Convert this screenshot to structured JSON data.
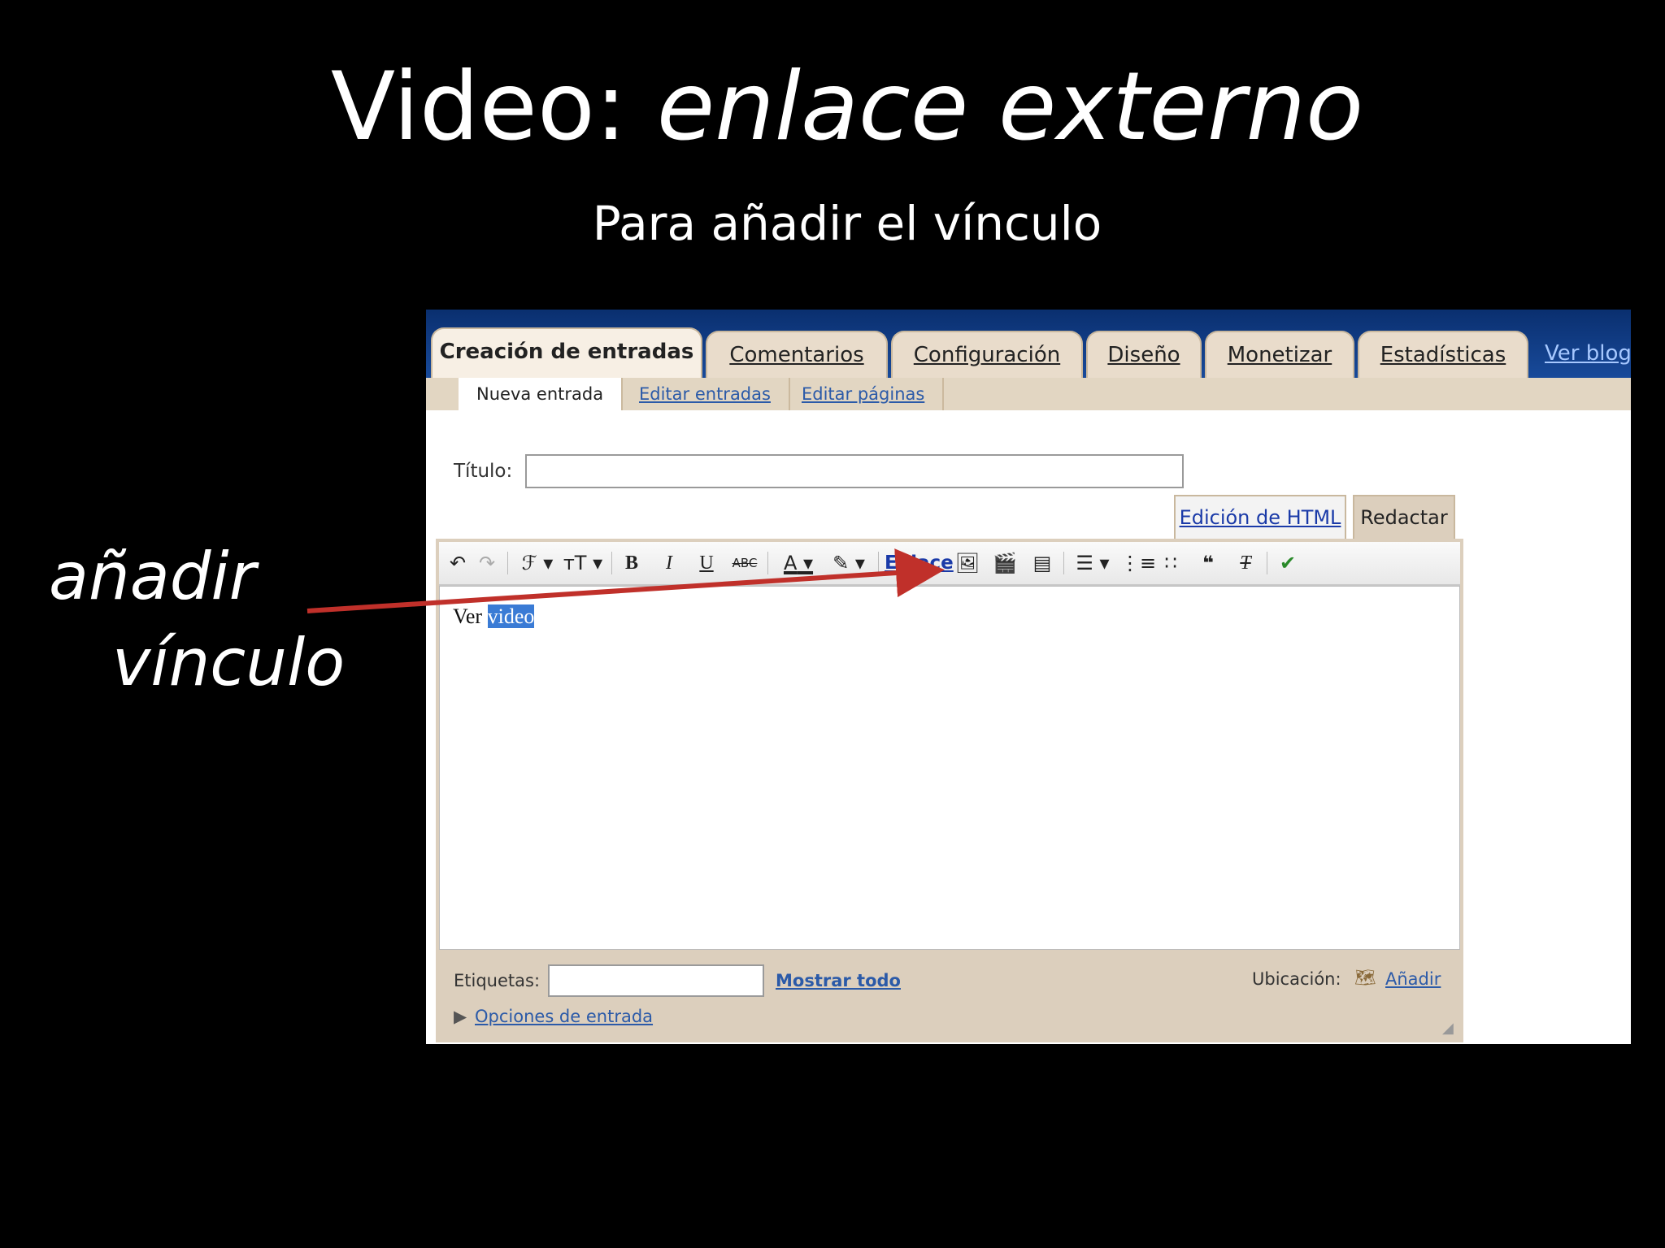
{
  "slide": {
    "title_plain": "Video:",
    "title_italic": "enlace externo",
    "subtitle": "Para añadir el vínculo",
    "annotation_line1": "añadir",
    "annotation_line2": "vínculo"
  },
  "tabs": [
    {
      "label": "Creación de entradas"
    },
    {
      "label": "Comentarios"
    },
    {
      "label": "Configuración"
    },
    {
      "label": "Diseño"
    },
    {
      "label": "Monetizar"
    },
    {
      "label": "Estadísticas"
    },
    {
      "label": "Ver blog"
    }
  ],
  "subtabs": [
    {
      "label": "Nueva entrada"
    },
    {
      "label": "Editar entradas"
    },
    {
      "label": "Editar páginas"
    }
  ],
  "form": {
    "title_label": "Título:",
    "title_value": "",
    "mode_html": "Edición de HTML",
    "mode_compose": "Redactar"
  },
  "toolbar": {
    "link_label": "Enlace",
    "bold": "B",
    "italic": "I",
    "underline": "U",
    "strike": "ABC",
    "font": "ℱ",
    "size": "тT",
    "color": "A",
    "quote": "❝",
    "removeformat": "T"
  },
  "editor": {
    "text_before": "Ver ",
    "selected_text": "video"
  },
  "footer": {
    "labels_label": "Etiquetas:",
    "show_all": "Mostrar todo",
    "location_label": "Ubicación:",
    "add": "Añadir",
    "options": "Opciones de entrada"
  },
  "colors": {
    "arrow": "#c0302a",
    "tab_bg": "#e9dccb",
    "link": "#2b5aa8",
    "selection": "#3a7bd5"
  }
}
